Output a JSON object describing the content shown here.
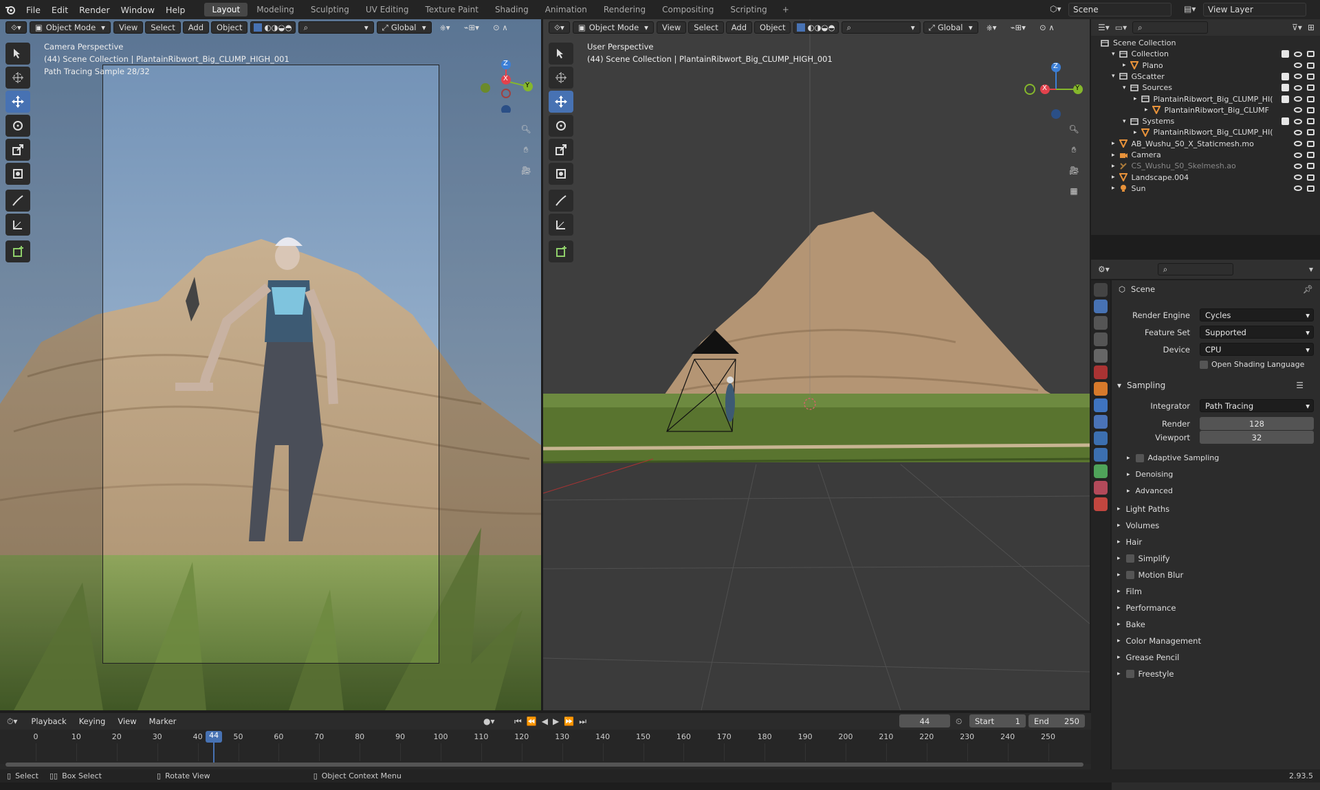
{
  "topbar": {
    "menus": [
      "File",
      "Edit",
      "Render",
      "Window",
      "Help"
    ],
    "workspaces": [
      "Layout",
      "Modeling",
      "Sculpting",
      "UV Editing",
      "Texture Paint",
      "Shading",
      "Animation",
      "Rendering",
      "Compositing",
      "Scripting"
    ],
    "active_workspace": "Layout",
    "scene": "Scene",
    "view_layer": "View Layer"
  },
  "viewport_left": {
    "mode": "Object Mode",
    "menus": [
      "View",
      "Select",
      "Add",
      "Object"
    ],
    "transform": "Global",
    "title": "Camera Perspective",
    "collection": "(44) Scene Collection | PlantainRibwort_Big_CLUMP_HIGH_001",
    "sample": "Path Tracing Sample 28/32"
  },
  "viewport_right": {
    "mode": "Object Mode",
    "menus": [
      "View",
      "Select",
      "Add",
      "Object"
    ],
    "transform": "Global",
    "title": "User Perspective",
    "collection": "(44) Scene Collection | PlantainRibwort_Big_CLUMP_HIGH_001"
  },
  "gizmo": {
    "x": "X",
    "y": "Y",
    "z": "Z",
    "x_color": "#e2424c",
    "y_color": "#85b72c",
    "z_color": "#3c7fd6"
  },
  "outliner": {
    "rows": [
      {
        "label": "Scene Collection",
        "icon": "collection",
        "indent": 0
      },
      {
        "label": "Collection",
        "icon": "collection",
        "indent": 1
      },
      {
        "label": "Plano",
        "icon": "mesh",
        "indent": 2
      },
      {
        "label": "GScatter",
        "icon": "collection",
        "indent": 1
      },
      {
        "label": "Sources",
        "icon": "collection",
        "indent": 2
      },
      {
        "label": "PlantainRibwort_Big_CLUMP_HI(",
        "icon": "collection",
        "indent": 3
      },
      {
        "label": "PlantainRibwort_Big_CLUMF",
        "icon": "mesh",
        "indent": 4
      },
      {
        "label": "Systems",
        "icon": "collection",
        "indent": 2
      },
      {
        "label": "PlantainRibwort_Big_CLUMP_HI(",
        "icon": "mesh",
        "indent": 3
      },
      {
        "label": "AB_Wushu_S0_X_Staticmesh.mo",
        "icon": "mesh",
        "indent": 1
      },
      {
        "label": "Camera",
        "icon": "camera",
        "indent": 1
      },
      {
        "label": "CS_Wushu_S0_Skelmesh.ao",
        "icon": "armature",
        "indent": 1
      },
      {
        "label": "Landscape.004",
        "icon": "mesh",
        "indent": 1
      },
      {
        "label": "Sun",
        "icon": "light",
        "indent": 1
      }
    ]
  },
  "properties": {
    "context": "Scene",
    "render_engine_label": "Render Engine",
    "render_engine": "Cycles",
    "feature_set_label": "Feature Set",
    "feature_set": "Supported",
    "device_label": "Device",
    "device": "CPU",
    "osl_label": "Open Shading Language",
    "sampling_label": "Sampling",
    "integrator_label": "Integrator",
    "integrator": "Path Tracing",
    "render_label": "Render",
    "render_samples": "128",
    "viewport_label": "Viewport",
    "viewport_samples": "32",
    "sub_panels": [
      "Adaptive Sampling",
      "Denoising",
      "Advanced"
    ],
    "panels": [
      "Light Paths",
      "Volumes",
      "Hair",
      "Simplify",
      "Motion Blur",
      "Film",
      "Performance",
      "Bake",
      "Color Management",
      "Grease Pencil",
      "Freestyle"
    ]
  },
  "timeline": {
    "menus": [
      "Playback",
      "Keying",
      "View",
      "Marker"
    ],
    "current_frame": "44",
    "start_label": "Start",
    "start": "1",
    "end_label": "End",
    "end": "250",
    "ticks": [
      "0",
      "10",
      "20",
      "30",
      "40",
      "50",
      "60",
      "70",
      "80",
      "90",
      "100",
      "110",
      "120",
      "130",
      "140",
      "150",
      "160",
      "170",
      "180",
      "190",
      "200",
      "210",
      "220",
      "230",
      "240",
      "250"
    ]
  },
  "statusbar": {
    "select": "Select",
    "box_select": "Box Select",
    "rotate": "Rotate View",
    "context_menu": "Object Context Menu",
    "version": "2.93.5"
  },
  "colors": {
    "accent": "#4772b3",
    "header": "#242424",
    "panel": "#2c2c2c"
  }
}
